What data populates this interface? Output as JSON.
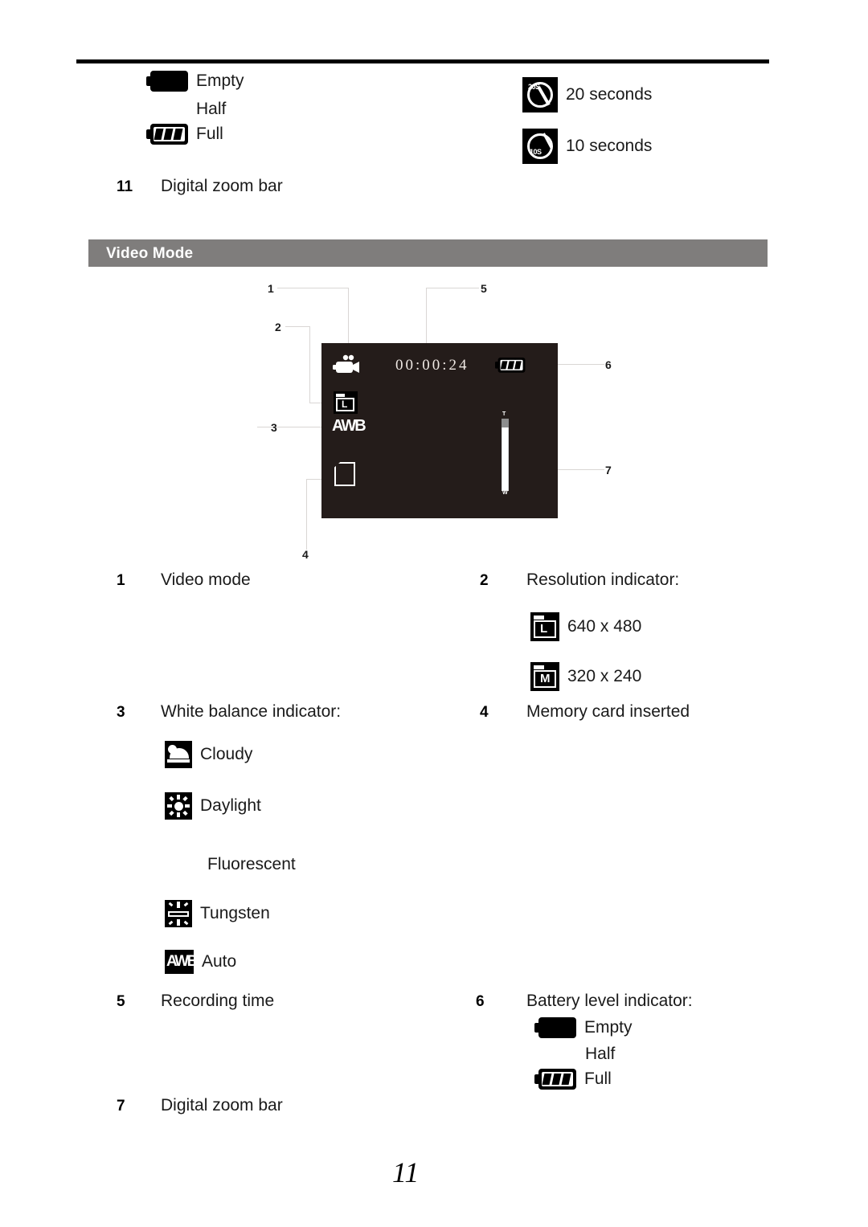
{
  "page": {
    "number": "11",
    "section_title": "Video Mode"
  },
  "top_section": {
    "battery_items": [
      {
        "label": "Empty",
        "icon": "battery-empty-icon",
        "has_icon": true
      },
      {
        "label": "Half",
        "icon": "battery-half-icon",
        "has_icon": false
      },
      {
        "label": "Full",
        "icon": "battery-full-icon",
        "has_icon": true
      }
    ],
    "timer_items": [
      {
        "label": "20 seconds",
        "icon": "self-timer-20s-icon",
        "badge": "20S"
      },
      {
        "label": "10 seconds",
        "icon": "self-timer-10s-icon",
        "badge": "10S"
      }
    ],
    "entry": {
      "number": "11",
      "text": "Digital zoom bar"
    }
  },
  "lcd": {
    "recording_time": "00:00:24",
    "white_balance_text": "AWB",
    "zoom_tele_label": "T",
    "zoom_wide_label": "W",
    "callouts": [
      "1",
      "2",
      "3",
      "4",
      "5",
      "6",
      "7"
    ]
  },
  "legend": [
    {
      "number": "1",
      "title": "Video mode"
    },
    {
      "number": "2",
      "title": "Resolution indicator:",
      "items": [
        {
          "icon": "resolution-large-icon",
          "glyph": "L",
          "label": "640 x 480"
        },
        {
          "icon": "resolution-medium-icon",
          "glyph": "M",
          "label": "320 x 240"
        }
      ]
    },
    {
      "number": "3",
      "title": "White balance indicator:",
      "items": [
        {
          "icon": "wb-cloudy-icon",
          "label": "Cloudy",
          "has_icon": true
        },
        {
          "icon": "wb-daylight-icon",
          "label": "Daylight",
          "has_icon": true
        },
        {
          "icon": "wb-fluorescent-icon",
          "label": "Fluorescent",
          "has_icon": false
        },
        {
          "icon": "wb-tungsten-icon",
          "label": "Tungsten",
          "has_icon": true
        },
        {
          "icon": "wb-auto-icon",
          "label": "Auto",
          "has_icon": true,
          "glyph": "AWB"
        }
      ]
    },
    {
      "number": "4",
      "title": "Memory card inserted"
    },
    {
      "number": "5",
      "title": "Recording time"
    },
    {
      "number": "6",
      "title": "Battery level indicator:",
      "items": [
        {
          "icon": "battery-empty-icon",
          "label": "Empty",
          "has_icon": true
        },
        {
          "icon": "battery-half-icon",
          "label": "Half",
          "has_icon": false
        },
        {
          "icon": "battery-full-icon",
          "label": "Full",
          "has_icon": true
        }
      ]
    },
    {
      "number": "7",
      "title": "Digital zoom bar"
    }
  ],
  "colors": {
    "banner_bg": "#7f7d7c",
    "lcd_bg": "#241c1a",
    "rule": "#000000",
    "callout_line": "#d9d6d4"
  }
}
